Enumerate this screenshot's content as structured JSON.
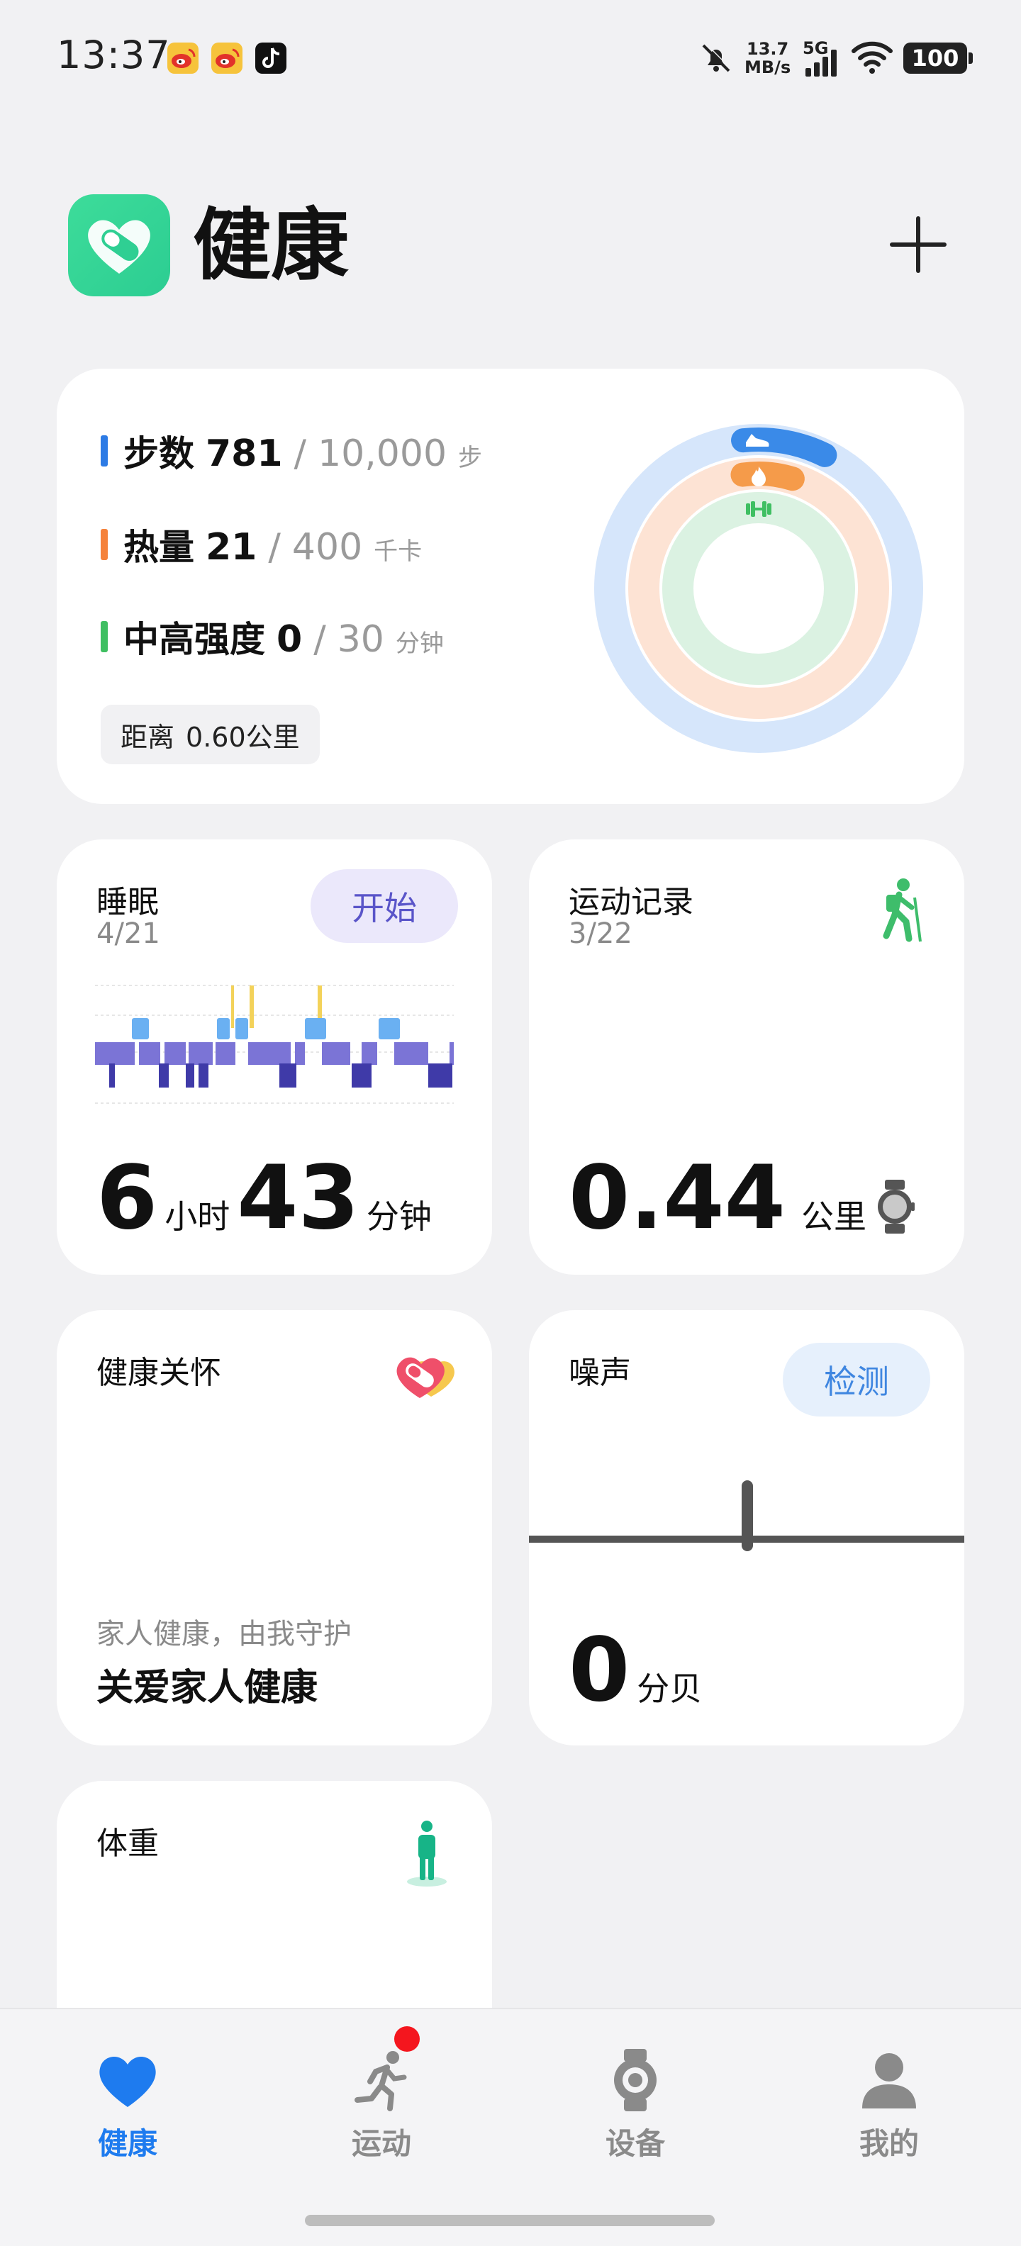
{
  "status_bar": {
    "time": "13:37",
    "notifications": [
      "weibo-icon",
      "weibo-icon",
      "tiktok-icon"
    ],
    "network_speed_value": "13.7",
    "network_speed_unit": "MB/s",
    "network_type": "5G",
    "battery": "100"
  },
  "header": {
    "title": "健康"
  },
  "activity": {
    "steps": {
      "label": "步数",
      "value": "781",
      "sep": "/",
      "goal": "10,000",
      "unit": "步",
      "color": "#2d7be5"
    },
    "calories": {
      "label": "热量",
      "value": "21",
      "sep": "/",
      "goal": "400",
      "unit": "千卡",
      "color": "#f5823b"
    },
    "intensity": {
      "label": "中高强度",
      "value": "0",
      "sep": "/",
      "goal": "30",
      "unit": "分钟",
      "color": "#3fbf62"
    },
    "distance": {
      "label": "距离",
      "value": "0.60公里"
    },
    "rings": {
      "steps_progress": 0.078,
      "calories_progress": 0.053,
      "intensity_progress": 0.0
    }
  },
  "sleep": {
    "title": "睡眠",
    "date": "4/21",
    "button": "开始",
    "hours": "6",
    "hours_unit": "小时",
    "minutes": "43",
    "minutes_unit": "分钟"
  },
  "exercise": {
    "title": "运动记录",
    "date": "3/22",
    "value": "0.44",
    "unit": "公里"
  },
  "care": {
    "title": "健康关怀",
    "hint": "家人健康，由我守护",
    "headline": "关爱家人健康"
  },
  "noise": {
    "title": "噪声",
    "button": "检测",
    "value": "0",
    "unit": "分贝"
  },
  "weight": {
    "title": "体重"
  },
  "nav": {
    "items": [
      {
        "label": "健康",
        "icon": "heart-icon",
        "active": true
      },
      {
        "label": "运动",
        "icon": "running-icon",
        "active": false,
        "badge": true
      },
      {
        "label": "设备",
        "icon": "watch-icon",
        "active": false
      },
      {
        "label": "我的",
        "icon": "person-icon",
        "active": false
      }
    ],
    "active_color": "#1e7bef"
  }
}
